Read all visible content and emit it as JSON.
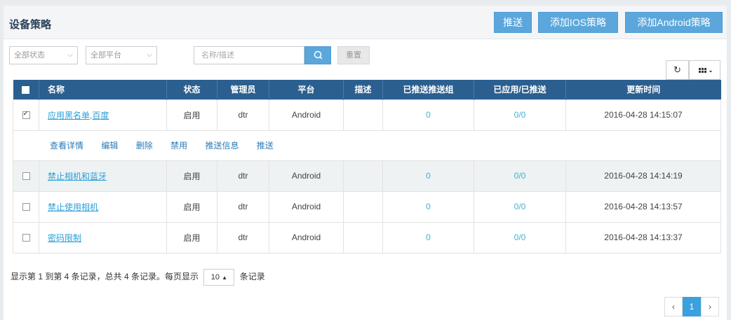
{
  "header": {
    "title": "设备策略",
    "buttons": {
      "push": "推送",
      "add_ios": "添加IOS策略",
      "add_android": "添加Android策略"
    }
  },
  "filters": {
    "status": "全部状态",
    "platform": "全部平台",
    "search_placeholder": "名称/描述",
    "reset": "重置"
  },
  "toolbar": {
    "refresh_icon": "refresh-icon",
    "columns_icon": "grid-icon"
  },
  "table": {
    "columns": [
      "名称",
      "状态",
      "管理员",
      "平台",
      "描述",
      "已推送推送组",
      "已应用/已推送",
      "更新时间"
    ],
    "rows": [
      {
        "name": "应用黑名单,百度",
        "status": "启用",
        "admin": "dtr",
        "platform": "Android",
        "desc": "",
        "pushed_groups": "0",
        "applied": "0/0",
        "updated": "2016-04-28 14:15:07",
        "checked": true
      },
      {
        "name": "禁止相机和蓝牙",
        "status": "启用",
        "admin": "dtr",
        "platform": "Android",
        "desc": "",
        "pushed_groups": "0",
        "applied": "0/0",
        "updated": "2016-04-28 14:14:19",
        "checked": false
      },
      {
        "name": "禁止使用相机",
        "status": "启用",
        "admin": "dtr",
        "platform": "Android",
        "desc": "",
        "pushed_groups": "0",
        "applied": "0/0",
        "updated": "2016-04-28 14:13:57",
        "checked": false
      },
      {
        "name": "密码限制",
        "status": "启用",
        "admin": "dtr",
        "platform": "Android",
        "desc": "",
        "pushed_groups": "0",
        "applied": "0/0",
        "updated": "2016-04-28 14:13:37",
        "checked": false
      }
    ],
    "row_actions": [
      "查看详情",
      "编辑",
      "删除",
      "禁用",
      "推送信息",
      "推送"
    ]
  },
  "footer": {
    "summary_prefix": "显示第 1 到第 4 条记录，总共 4 条记录。每页显示",
    "page_size": "10",
    "summary_suffix": "条记录"
  },
  "pagination": {
    "prev": "‹",
    "current": "1",
    "next": "›"
  },
  "colors": {
    "accent": "#5ba7dc",
    "table_header": "#2b5f8f",
    "link": "#2a9fd8"
  }
}
